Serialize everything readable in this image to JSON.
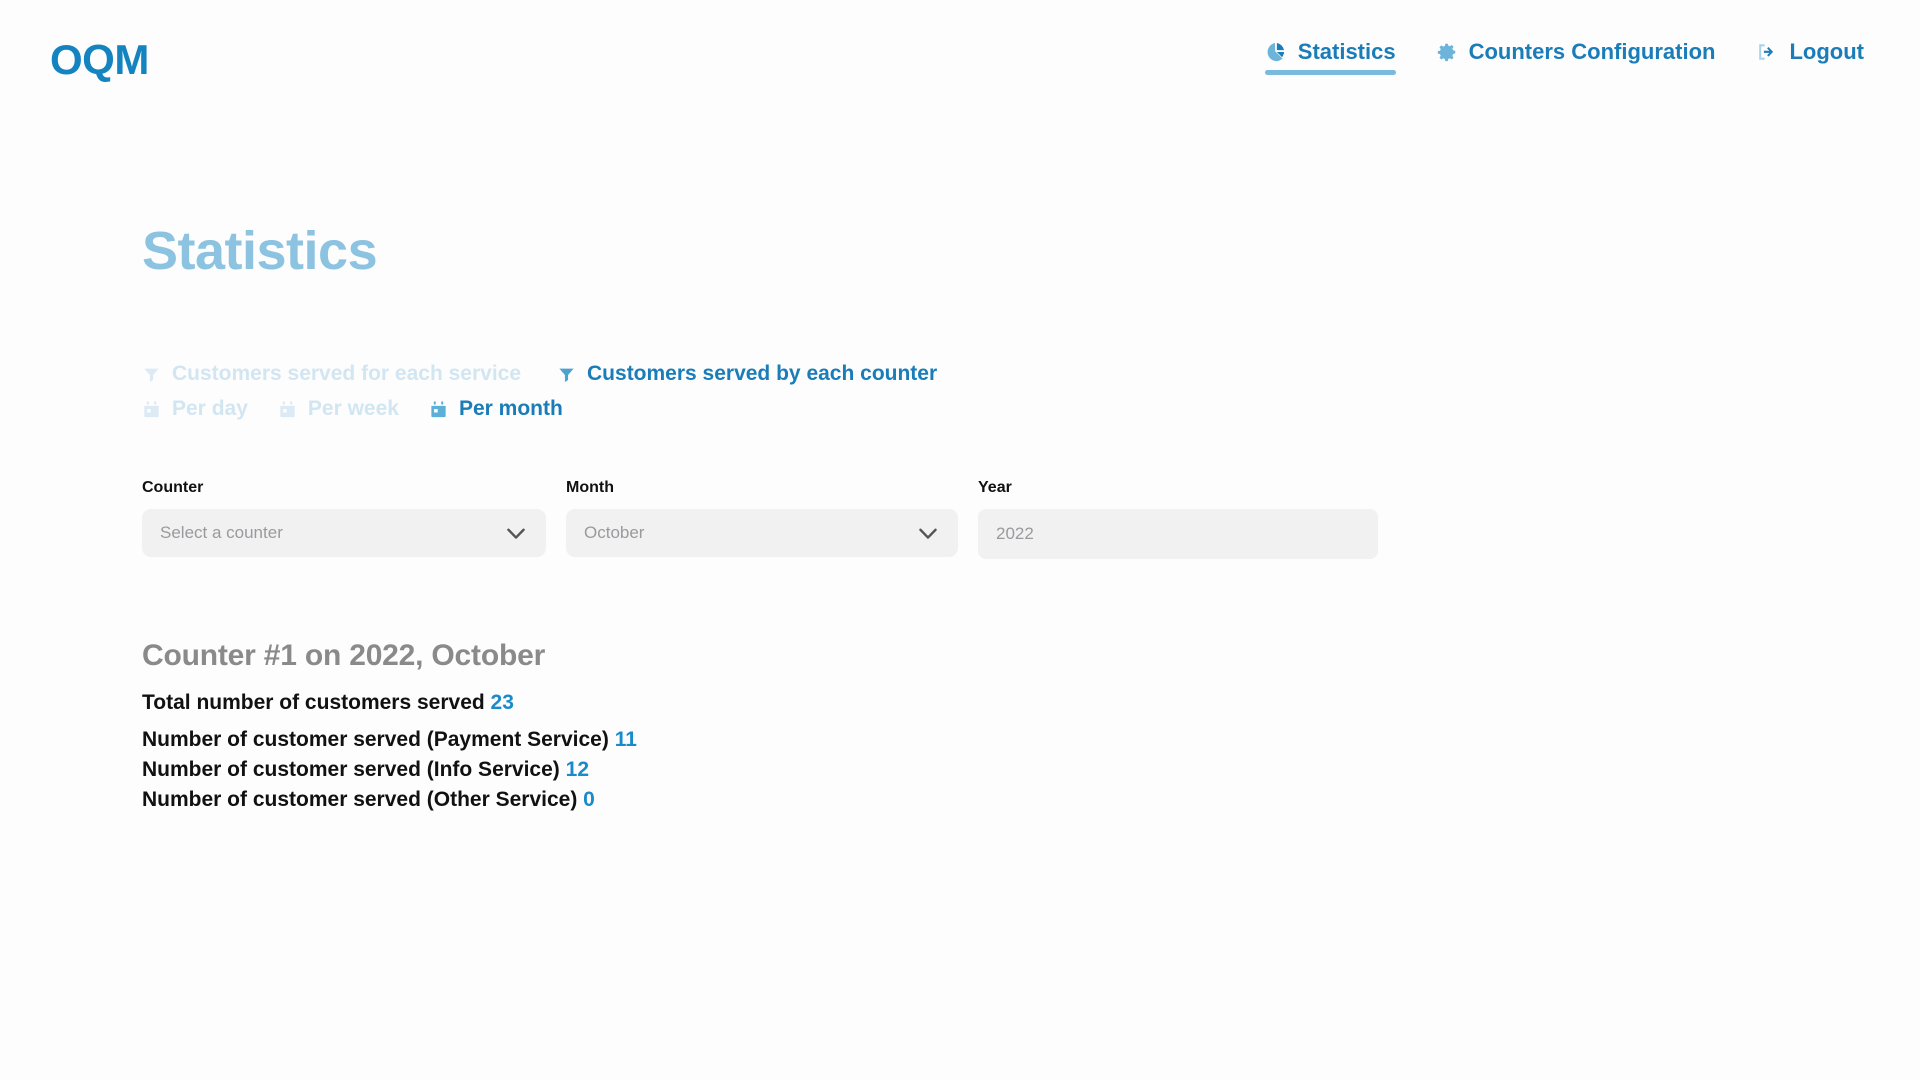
{
  "brand": {
    "logo": "OQM",
    "color": "#1484c0"
  },
  "nav": {
    "items": [
      {
        "label": "Statistics",
        "icon": "pie-chart-icon",
        "active": true
      },
      {
        "label": "Counters Configuration",
        "icon": "gear-icon",
        "active": false
      },
      {
        "label": "Logout",
        "icon": "sign-out-icon",
        "active": false
      }
    ]
  },
  "page": {
    "title": "Statistics"
  },
  "view_tabs": [
    {
      "label": "Customers served for each service",
      "icon": "filter-icon",
      "active": false
    },
    {
      "label": "Customers served by each counter",
      "icon": "filter-icon",
      "active": true
    }
  ],
  "period_tabs": [
    {
      "label": "Per day",
      "icon": "calendar-icon",
      "active": false
    },
    {
      "label": "Per week",
      "icon": "calendar-icon",
      "active": false
    },
    {
      "label": "Per month",
      "icon": "calendar-icon",
      "active": true
    }
  ],
  "filters": {
    "counter": {
      "label": "Counter",
      "placeholder": "Select a counter",
      "value": "Select a counter",
      "chevron": "chevron-down-icon"
    },
    "month": {
      "label": "Month",
      "placeholder": "October",
      "value": "October",
      "chevron": "chevron-down-icon"
    },
    "year": {
      "label": "Year",
      "placeholder": "2022",
      "value": "2022"
    }
  },
  "results": {
    "title": "Counter #1 on 2022, October",
    "total_label": "Total number of customers served",
    "total_value": "23",
    "lines": [
      {
        "label": "Number of customer served (Payment Service)",
        "value": "11"
      },
      {
        "label": "Number of customer served (Info Service)",
        "value": "12"
      },
      {
        "label": "Number of customer served (Other Service)",
        "value": "0"
      }
    ]
  },
  "colors": {
    "accent": "#1a7cb8",
    "accent_number": "#1a8bc9",
    "title": "#8cc3e0",
    "inactive": "#d2e6f2",
    "underline": "#79bade",
    "field_bg": "#f1f1f2"
  }
}
